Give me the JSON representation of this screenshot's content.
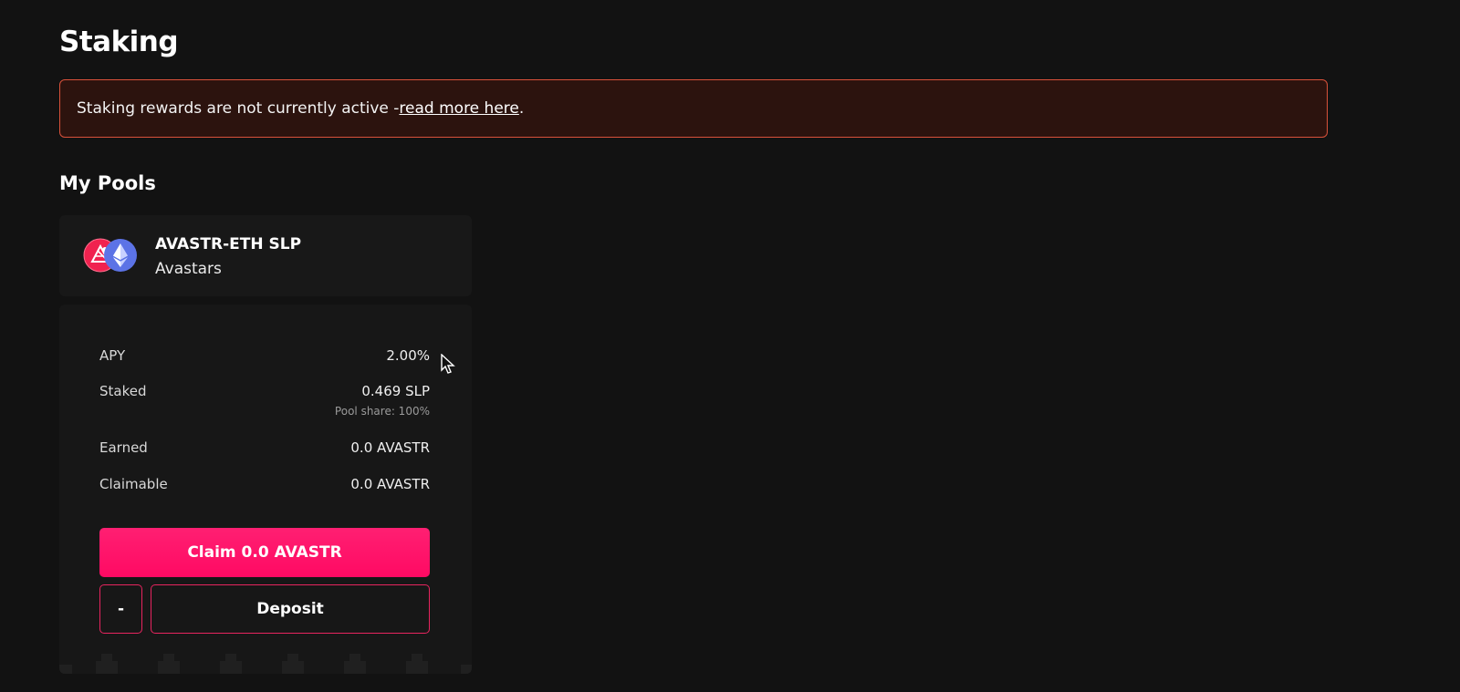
{
  "page": {
    "title": "Staking"
  },
  "alert": {
    "text": "Staking rewards are not currently active - ",
    "link_text": "read more here",
    "suffix": "."
  },
  "my_pools": {
    "title": "My Pools",
    "pool": {
      "name": "AVASTR-ETH SLP",
      "project": "Avastars",
      "icons": [
        "avastar-token-icon",
        "ethereum-token-icon"
      ],
      "stats": {
        "apy": {
          "label": "APY",
          "value": "2.00%"
        },
        "staked": {
          "label": "Staked",
          "value": "0.469 SLP",
          "pool_share": "Pool share: 100%"
        },
        "earned": {
          "label": "Earned",
          "value": "0.0 AVASTR"
        },
        "claimable": {
          "label": "Claimable",
          "value": "0.0 AVASTR"
        }
      },
      "actions": {
        "claim_label": "Claim 0.0 AVASTR",
        "withdraw_label": "-",
        "deposit_label": "Deposit"
      }
    }
  },
  "colors": {
    "background": "#121212",
    "alert_border": "#d9513a",
    "alert_background": "#2c130e",
    "accent": "#ff1f72"
  }
}
